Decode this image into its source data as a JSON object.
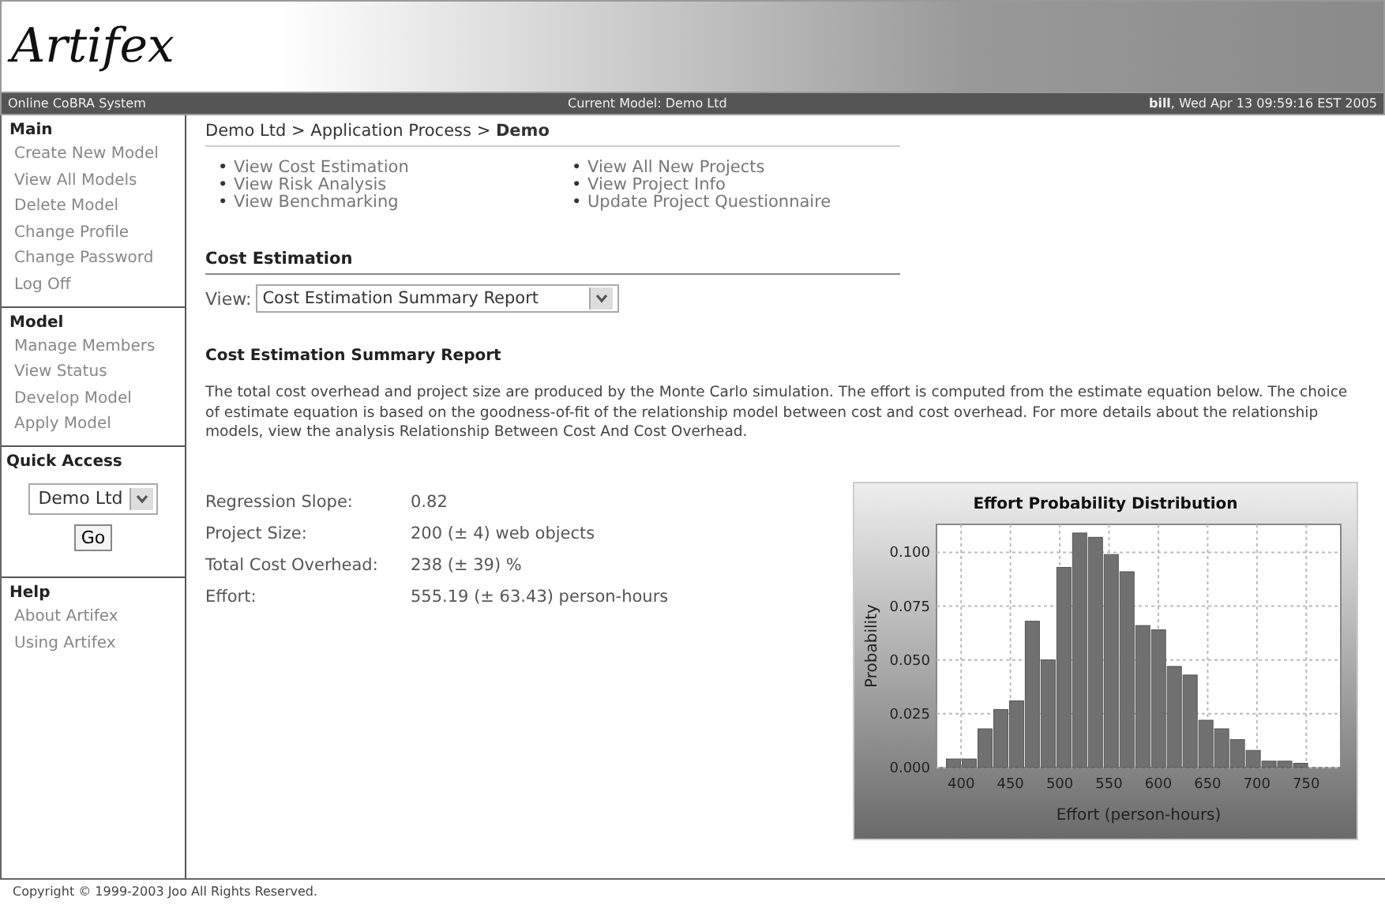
{
  "header": {
    "logo": "Artifex"
  },
  "status_bar": {
    "system": "Online CoBRA System",
    "model": "Current Model: Demo Ltd",
    "user": "bill",
    "datetime": ", Wed Apr 13 09:59:16 EST 2005"
  },
  "sidebar": {
    "sections": [
      {
        "title": "Main",
        "items": [
          {
            "label": "Create New Model"
          },
          {
            "label": "View All Models"
          },
          {
            "label": "Delete Model"
          },
          {
            "label": "Change Profile"
          },
          {
            "label": "Change Password"
          },
          {
            "label": "Log Off"
          }
        ]
      },
      {
        "title": "Model",
        "items": [
          {
            "label": "Manage Members"
          },
          {
            "label": "View Status"
          },
          {
            "label": "Develop Model"
          },
          {
            "label": "Apply Model"
          }
        ]
      }
    ],
    "quick_access": {
      "title": "Quick Access",
      "select": "Demo Ltd",
      "button": "Go"
    },
    "help": {
      "title": "Help",
      "items": [
        {
          "label": "About Artifex"
        },
        {
          "label": "Using Artifex"
        }
      ]
    }
  },
  "breadcrumb": {
    "parts": [
      "Demo Ltd > Application Process > "
    ],
    "current": "Demo"
  },
  "links": [
    [
      {
        "bullet": "•",
        "label": "View Cost Estimation"
      },
      {
        "bullet": "•",
        "label": "View Risk Analysis"
      },
      {
        "bullet": "•",
        "label": "View Benchmarking"
      }
    ],
    [
      {
        "bullet": "•",
        "label": "View All New Projects"
      },
      {
        "bullet": "•",
        "label": "View Project Info"
      },
      {
        "bullet": "•",
        "label": "Update Project Questionnaire"
      }
    ]
  ],
  "section": {
    "title": "Cost Estimation",
    "view_label": "View:",
    "view_select": "Cost Estimation Summary Report"
  },
  "report": {
    "title": "Cost Estimation Summary Report",
    "description": "The total cost overhead and project size are produced by the Monte Carlo simulation. The effort is computed from the estimate equation below. The choice of estimate equation is based on the goodness-of-fit of the relationship model between cost and cost overhead. For more details about the relationship models, view the analysis Relationship Between Cost And Cost Overhead.",
    "metrics": [
      {
        "label": "Regression Slope:",
        "value": "0.82"
      },
      {
        "label": "Project Size:",
        "value": "200 (± 4) web objects"
      },
      {
        "label": "Total Cost Overhead:",
        "value": "238 (± 39) %"
      },
      {
        "label": "Effort:",
        "value": "555.19 (± 63.43) person-hours"
      }
    ],
    "chart_data": {
      "type": "bar",
      "title": "Effort Probability Distribution",
      "xlabel": "Effort (person-hours)",
      "ylabel": "Probability",
      "x": [
        393,
        409,
        425,
        441,
        457,
        473,
        489,
        505,
        521,
        537,
        553,
        569,
        585,
        601,
        617,
        633,
        649,
        665,
        681,
        697,
        713,
        729,
        745
      ],
      "grid": true,
      "series": [
        {
          "color": "#707070",
          "values": [
            0.004,
            0.004,
            0.018,
            0.027,
            0.031,
            0.068,
            0.05,
            0.093,
            0.109,
            0.107,
            0.099,
            0.091,
            0.066,
            0.064,
            0.047,
            0.043,
            0.022,
            0.018,
            0.013,
            0.008,
            0.003,
            0.003,
            0.002
          ]
        }
      ],
      "xlim": [
        375,
        785
      ],
      "ylim": [
        0,
        0.113
      ],
      "xticks": [
        400,
        450,
        500,
        550,
        600,
        650,
        700,
        750
      ],
      "yticks": [
        {
          "value": 0,
          "label": "0.000"
        },
        {
          "value": 0.025,
          "label": "0.025"
        },
        {
          "value": 0.05,
          "label": "0.050"
        },
        {
          "value": 0.075,
          "label": "0.075"
        },
        {
          "value": 0.1,
          "label": "0.100"
        }
      ]
    }
  },
  "footer": {
    "copyright": "Copyright © 1999-2003 Joo All Rights Reserved."
  }
}
